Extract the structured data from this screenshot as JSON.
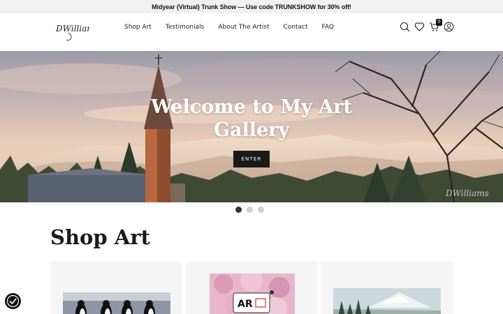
{
  "announcement": {
    "text": "Midyear (Virtual) Trunk Show — Use code TRUNKSHOW for 30% off!"
  },
  "header": {
    "logo_text": "DWilliams",
    "nav": [
      {
        "label": "Shop Art"
      },
      {
        "label": "Testimonials"
      },
      {
        "label": "About The Artist"
      },
      {
        "label": "Contact"
      },
      {
        "label": "FAQ"
      }
    ],
    "icons": [
      "search-icon",
      "heart-icon",
      "cart-icon",
      "account-icon"
    ],
    "cart_count": "0"
  },
  "hero": {
    "title_line1": "Welcome to My Art",
    "title_line2": "Gallery",
    "button_label": "ENTER",
    "signature": "DWilliams"
  },
  "carousel": {
    "slides": 3,
    "active": 1
  },
  "shop": {
    "title": "Shop Art",
    "badge_text": "AR"
  },
  "colors": {
    "accent": "#1a1a1a",
    "announcement_bg": "#f1f1f1",
    "card_bg": "#f5f5f5"
  }
}
